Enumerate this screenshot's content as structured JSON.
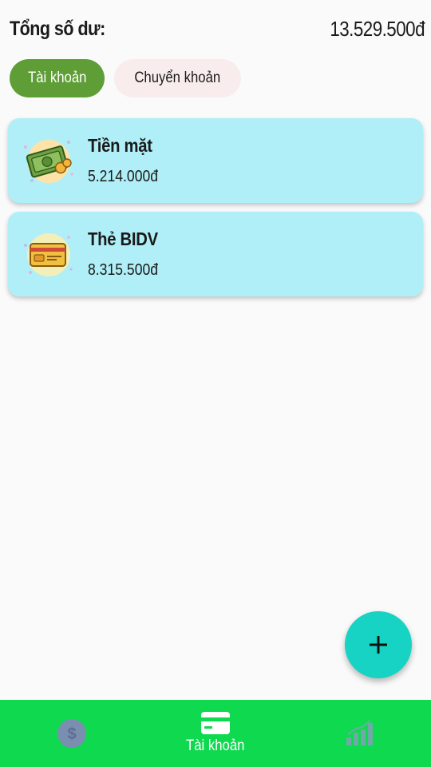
{
  "header": {
    "title": "Tổng số dư:",
    "total": "13.529.500đ"
  },
  "tabs": [
    {
      "label": "Tài khoản",
      "active": true
    },
    {
      "label": "Chuyển khoản",
      "active": false
    }
  ],
  "accounts": [
    {
      "name": "Tiền mặt",
      "amount": "5.214.000đ",
      "icon": "cash-icon"
    },
    {
      "name": "Thẻ BIDV",
      "amount": "8.315.500đ",
      "icon": "bank-card-icon"
    }
  ],
  "fab": {
    "icon": "plus-icon"
  },
  "bottom_nav": [
    {
      "icon": "dollar-coin-icon",
      "label": "",
      "active": false
    },
    {
      "icon": "credit-card-icon",
      "label": "Tài khoản",
      "active": true
    },
    {
      "icon": "bar-chart-icon",
      "label": "",
      "active": false
    }
  ],
  "colors": {
    "background": "#fafafa",
    "active_tab": "#5f9e36",
    "inactive_tab": "#f8ecec",
    "card": "#b0eff7",
    "fab": "#16d3c3",
    "bottom_nav": "#0fd94f"
  }
}
